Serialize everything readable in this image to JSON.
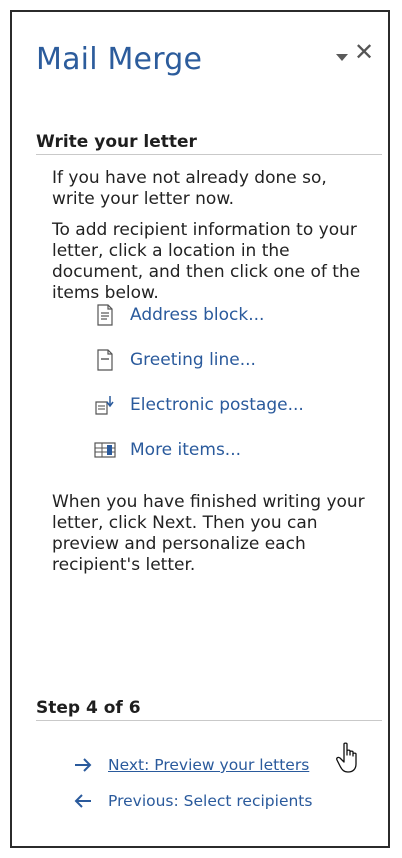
{
  "pane": {
    "title": "Mail Merge",
    "menu_icon": "dropdown-caret-icon",
    "close_icon": "close-icon",
    "close_glyph": "✕"
  },
  "section": {
    "heading": "Write your letter",
    "para1": "If you have not already done so, write your letter now.",
    "para2": "To add recipient information to your letter, click a location in the document, and then click one of the items below.",
    "para3": "When you have finished writing your letter, click Next. Then you can preview and personalize each recipient's letter."
  },
  "items": [
    {
      "label": "Address block...",
      "icon": "address-block-icon"
    },
    {
      "label": "Greeting line...",
      "icon": "greeting-line-icon"
    },
    {
      "label": "Electronic postage...",
      "icon": "electronic-postage-icon"
    },
    {
      "label": "More items...",
      "icon": "more-items-icon"
    }
  ],
  "step": {
    "label": "Step 4 of 6",
    "next_label": "Next: Preview your letters",
    "previous_label": "Previous: Select recipients"
  },
  "colors": {
    "title": "#2c5c9c",
    "link": "#2a5a9c",
    "arrow": "#2a5a9c"
  }
}
